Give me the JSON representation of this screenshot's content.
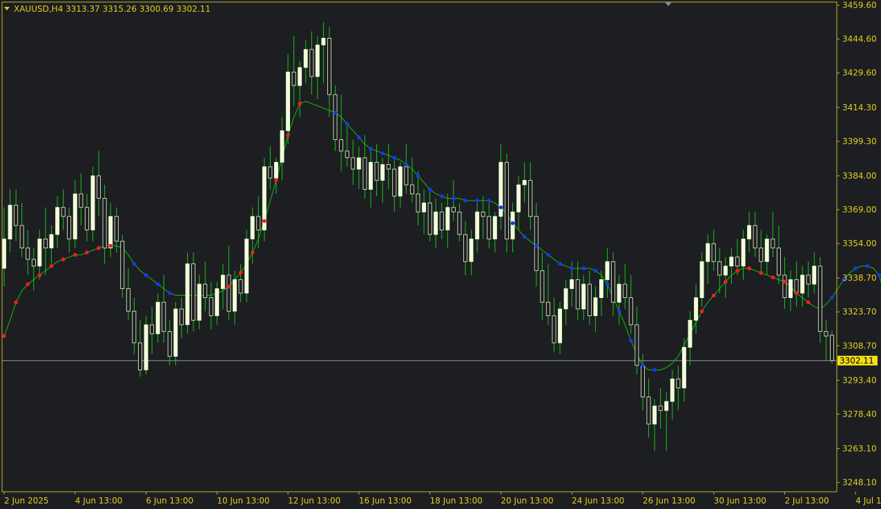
{
  "header": {
    "symbol_timeframe": "XAUUSD,H4",
    "ohlc": "3313.37 3315.26 3300.69 3302.11"
  },
  "colors": {
    "background": "#1d1e22",
    "frame": "#c9b82e",
    "axis_text": "#e2cf1e",
    "candle_bull_fill": "#f0ffd8",
    "candle_bear_fill": "#1d1e22",
    "candle_outline": "#f0ffd8",
    "wick": "#17c917",
    "ma_line": "#12a012",
    "dot_up": "#ff1a1a",
    "dot_down": "#1238ff",
    "last_price_bg": "#f5dd14",
    "last_price_line": "#9a9a9a"
  },
  "chart_data": {
    "type": "candlestick",
    "symbol": "XAUUSD",
    "timeframe": "H4",
    "y_ticks": [
      "3459.60",
      "3444.60",
      "3429.60",
      "3414.30",
      "3399.30",
      "3384.00",
      "3369.00",
      "3354.00",
      "3338.70",
      "3323.70",
      "3308.70",
      "3293.40",
      "3278.40",
      "3263.10",
      "3248.10"
    ],
    "ylim": [
      3244.0,
      3461.0
    ],
    "x_ticks": [
      {
        "i": 0,
        "label": "2 Jun 2025"
      },
      {
        "i": 12,
        "label": "4 Jun 13:00"
      },
      {
        "i": 24,
        "label": "6 Jun 13:00"
      },
      {
        "i": 36,
        "label": "10 Jun 13:00"
      },
      {
        "i": 48,
        "label": "12 Jun 13:00"
      },
      {
        "i": 60,
        "label": "16 Jun 13:00"
      },
      {
        "i": 72,
        "label": "18 Jun 13:00"
      },
      {
        "i": 84,
        "label": "20 Jun 13:00"
      },
      {
        "i": 96,
        "label": "24 Jun 13:00"
      },
      {
        "i": 108,
        "label": "26 Jun 13:00"
      },
      {
        "i": 120,
        "label": "30 Jun 13:00"
      },
      {
        "i": 132,
        "label": "2 Jul 13:00"
      },
      {
        "i": 144,
        "label": "4 Jul 13:00"
      }
    ],
    "last_price": "3302.11",
    "candles_ohlc": [
      [
        3343,
        3370,
        3335,
        3356
      ],
      [
        3356,
        3378,
        3350,
        3371
      ],
      [
        3371,
        3378,
        3355,
        3362
      ],
      [
        3362,
        3372,
        3348,
        3352
      ],
      [
        3352,
        3360,
        3340,
        3347
      ],
      [
        3347,
        3352,
        3333,
        3344
      ],
      [
        3344,
        3360,
        3338,
        3356
      ],
      [
        3356,
        3370,
        3340,
        3352
      ],
      [
        3352,
        3362,
        3345,
        3358
      ],
      [
        3358,
        3375,
        3352,
        3370
      ],
      [
        3370,
        3378,
        3360,
        3366
      ],
      [
        3366,
        3370,
        3350,
        3356
      ],
      [
        3356,
        3382,
        3352,
        3376
      ],
      [
        3376,
        3385,
        3362,
        3370
      ],
      [
        3370,
        3376,
        3355,
        3360
      ],
      [
        3360,
        3388,
        3355,
        3384
      ],
      [
        3384,
        3395,
        3366,
        3374
      ],
      [
        3374,
        3380,
        3345,
        3352
      ],
      [
        3352,
        3372,
        3348,
        3366
      ],
      [
        3366,
        3370,
        3350,
        3355
      ],
      [
        3355,
        3358,
        3330,
        3334
      ],
      [
        3334,
        3343,
        3320,
        3324
      ],
      [
        3324,
        3330,
        3305,
        3310
      ],
      [
        3310,
        3320,
        3295,
        3298
      ],
      [
        3298,
        3322,
        3296,
        3318
      ],
      [
        3318,
        3326,
        3305,
        3314
      ],
      [
        3314,
        3332,
        3310,
        3328
      ],
      [
        3328,
        3340,
        3310,
        3315
      ],
      [
        3315,
        3320,
        3300,
        3304
      ],
      [
        3304,
        3328,
        3300,
        3325
      ],
      [
        3325,
        3330,
        3312,
        3318
      ],
      [
        3318,
        3350,
        3314,
        3345
      ],
      [
        3345,
        3350,
        3315,
        3320
      ],
      [
        3320,
        3340,
        3316,
        3336
      ],
      [
        3336,
        3346,
        3324,
        3330
      ],
      [
        3330,
        3337,
        3316,
        3322
      ],
      [
        3322,
        3337,
        3318,
        3334
      ],
      [
        3334,
        3345,
        3325,
        3340
      ],
      [
        3340,
        3353,
        3320,
        3324
      ],
      [
        3324,
        3342,
        3318,
        3338
      ],
      [
        3338,
        3345,
        3328,
        3332
      ],
      [
        3332,
        3360,
        3328,
        3356
      ],
      [
        3356,
        3370,
        3345,
        3366
      ],
      [
        3366,
        3375,
        3352,
        3360
      ],
      [
        3360,
        3392,
        3355,
        3388
      ],
      [
        3388,
        3397,
        3378,
        3383
      ],
      [
        3383,
        3392,
        3376,
        3390
      ],
      [
        3390,
        3410,
        3382,
        3404
      ],
      [
        3404,
        3438,
        3398,
        3430
      ],
      [
        3430,
        3446,
        3415,
        3424
      ],
      [
        3424,
        3435,
        3410,
        3432
      ],
      [
        3432,
        3444,
        3425,
        3440
      ],
      [
        3440,
        3448,
        3420,
        3428
      ],
      [
        3428,
        3446,
        3418,
        3442
      ],
      [
        3442,
        3452,
        3425,
        3445
      ],
      [
        3445,
        3450,
        3410,
        3420
      ],
      [
        3420,
        3424,
        3395,
        3400
      ],
      [
        3400,
        3420,
        3386,
        3395
      ],
      [
        3395,
        3408,
        3388,
        3392
      ],
      [
        3392,
        3400,
        3380,
        3387
      ],
      [
        3387,
        3397,
        3378,
        3392
      ],
      [
        3392,
        3402,
        3374,
        3378
      ],
      [
        3378,
        3396,
        3370,
        3390
      ],
      [
        3390,
        3398,
        3375,
        3382
      ],
      [
        3382,
        3392,
        3372,
        3389
      ],
      [
        3389,
        3398,
        3378,
        3387
      ],
      [
        3387,
        3392,
        3368,
        3375
      ],
      [
        3375,
        3390,
        3370,
        3388
      ],
      [
        3388,
        3398,
        3376,
        3380
      ],
      [
        3380,
        3392,
        3372,
        3376
      ],
      [
        3376,
        3386,
        3362,
        3368
      ],
      [
        3368,
        3378,
        3358,
        3372
      ],
      [
        3372,
        3378,
        3355,
        3358
      ],
      [
        3358,
        3374,
        3352,
        3368
      ],
      [
        3368,
        3372,
        3356,
        3360
      ],
      [
        3360,
        3376,
        3352,
        3370
      ],
      [
        3370,
        3382,
        3364,
        3368
      ],
      [
        3368,
        3372,
        3355,
        3358
      ],
      [
        3358,
        3364,
        3340,
        3346
      ],
      [
        3346,
        3360,
        3340,
        3356
      ],
      [
        3356,
        3372,
        3350,
        3368
      ],
      [
        3368,
        3375,
        3356,
        3366
      ],
      [
        3366,
        3372,
        3352,
        3356
      ],
      [
        3356,
        3368,
        3350,
        3366
      ],
      [
        3366,
        3398,
        3360,
        3390
      ],
      [
        3390,
        3394,
        3350,
        3356
      ],
      [
        3356,
        3372,
        3350,
        3368
      ],
      [
        3368,
        3384,
        3360,
        3380
      ],
      [
        3380,
        3390,
        3372,
        3382
      ],
      [
        3382,
        3390,
        3360,
        3366
      ],
      [
        3366,
        3372,
        3335,
        3342
      ],
      [
        3342,
        3350,
        3320,
        3328
      ],
      [
        3328,
        3345,
        3318,
        3322
      ],
      [
        3322,
        3330,
        3306,
        3310
      ],
      [
        3310,
        3328,
        3305,
        3325
      ],
      [
        3325,
        3338,
        3318,
        3334
      ],
      [
        3334,
        3346,
        3326,
        3338
      ],
      [
        3338,
        3346,
        3320,
        3325
      ],
      [
        3325,
        3340,
        3320,
        3336
      ],
      [
        3336,
        3342,
        3318,
        3322
      ],
      [
        3322,
        3335,
        3315,
        3330
      ],
      [
        3330,
        3342,
        3322,
        3338
      ],
      [
        3338,
        3352,
        3330,
        3346
      ],
      [
        3346,
        3350,
        3322,
        3328
      ],
      [
        3328,
        3340,
        3318,
        3336
      ],
      [
        3336,
        3345,
        3325,
        3330
      ],
      [
        3330,
        3340,
        3314,
        3318
      ],
      [
        3318,
        3326,
        3296,
        3300
      ],
      [
        3300,
        3305,
        3280,
        3286
      ],
      [
        3286,
        3294,
        3268,
        3274
      ],
      [
        3274,
        3285,
        3262,
        3282
      ],
      [
        3282,
        3290,
        3272,
        3280
      ],
      [
        3280,
        3288,
        3262,
        3284
      ],
      [
        3284,
        3298,
        3276,
        3294
      ],
      [
        3294,
        3300,
        3280,
        3290
      ],
      [
        3290,
        3312,
        3284,
        3308
      ],
      [
        3308,
        3324,
        3300,
        3320
      ],
      [
        3320,
        3336,
        3314,
        3330
      ],
      [
        3330,
        3350,
        3326,
        3346
      ],
      [
        3346,
        3358,
        3336,
        3354
      ],
      [
        3354,
        3360,
        3342,
        3346
      ],
      [
        3346,
        3352,
        3332,
        3340
      ],
      [
        3340,
        3348,
        3330,
        3344
      ],
      [
        3344,
        3352,
        3336,
        3348
      ],
      [
        3348,
        3356,
        3340,
        3344
      ],
      [
        3344,
        3360,
        3338,
        3356
      ],
      [
        3356,
        3368,
        3350,
        3362
      ],
      [
        3362,
        3368,
        3348,
        3352
      ],
      [
        3352,
        3360,
        3340,
        3346
      ],
      [
        3346,
        3358,
        3340,
        3356
      ],
      [
        3356,
        3368,
        3348,
        3352
      ],
      [
        3352,
        3362,
        3336,
        3340
      ],
      [
        3340,
        3348,
        3325,
        3330
      ],
      [
        3330,
        3342,
        3324,
        3338
      ],
      [
        3338,
        3346,
        3326,
        3332
      ],
      [
        3332,
        3344,
        3326,
        3340
      ],
      [
        3340,
        3346,
        3330,
        3336
      ],
      [
        3336,
        3350,
        3332,
        3344
      ],
      [
        3344,
        3348,
        3310,
        3315
      ],
      [
        3315,
        3320,
        3302,
        3313
      ],
      [
        3313.37,
        3315.26,
        3300.69,
        3302.11
      ]
    ],
    "ma_values": [
      3313,
      3320,
      3328,
      3333,
      3336,
      3338,
      3340,
      3342,
      3344,
      3346,
      3347,
      3348,
      3349,
      3349,
      3350,
      3351,
      3352,
      3353,
      3353,
      3353,
      3352,
      3349,
      3345,
      3342,
      3340,
      3338,
      3336,
      3334,
      3332,
      3331,
      3331,
      3331,
      3331,
      3331,
      3331,
      3331,
      3332,
      3333,
      3335,
      3338,
      3341,
      3345,
      3350,
      3356,
      3364,
      3373,
      3382,
      3392,
      3402,
      3410,
      3416,
      3417,
      3416,
      3415,
      3414,
      3413,
      3412,
      3410,
      3407,
      3404,
      3401,
      3398,
      3396,
      3395,
      3394,
      3393,
      3392,
      3391,
      3389,
      3387,
      3384,
      3381,
      3378,
      3376,
      3375,
      3374,
      3374,
      3374,
      3373,
      3373,
      3373,
      3373,
      3373,
      3372,
      3370,
      3367,
      3363,
      3360,
      3357,
      3355,
      3353,
      3351,
      3349,
      3347,
      3345,
      3344,
      3343,
      3343,
      3343,
      3343,
      3342,
      3340,
      3336,
      3330,
      3324,
      3318,
      3311,
      3305,
      3300,
      3298,
      3298,
      3298,
      3299,
      3301,
      3304,
      3309,
      3314,
      3319,
      3324,
      3328,
      3331,
      3334,
      3337,
      3340,
      3342,
      3343,
      3343,
      3342,
      3341,
      3340,
      3339,
      3338,
      3337,
      3335,
      3332,
      3330,
      3328,
      3326,
      3325,
      3327,
      3330,
      3334,
      3338,
      3341,
      3343,
      3344,
      3344,
      3343,
      3340,
      3330
    ],
    "dots": [
      {
        "i": 0,
        "c": "red"
      },
      {
        "i": 2,
        "c": "red"
      },
      {
        "i": 4,
        "c": "red"
      },
      {
        "i": 6,
        "c": "red"
      },
      {
        "i": 8,
        "c": "red"
      },
      {
        "i": 10,
        "c": "red"
      },
      {
        "i": 12,
        "c": "red"
      },
      {
        "i": 14,
        "c": "red"
      },
      {
        "i": 16,
        "c": "red"
      },
      {
        "i": 18,
        "c": "red"
      },
      {
        "i": 22,
        "c": "blue"
      },
      {
        "i": 24,
        "c": "blue"
      },
      {
        "i": 26,
        "c": "blue"
      },
      {
        "i": 28,
        "c": "blue"
      },
      {
        "i": 38,
        "c": "red"
      },
      {
        "i": 40,
        "c": "red"
      },
      {
        "i": 42,
        "c": "red"
      },
      {
        "i": 44,
        "c": "red"
      },
      {
        "i": 46,
        "c": "red"
      },
      {
        "i": 48,
        "c": "red"
      },
      {
        "i": 50,
        "c": "red"
      },
      {
        "i": 56,
        "c": "blue"
      },
      {
        "i": 58,
        "c": "blue"
      },
      {
        "i": 60,
        "c": "blue"
      },
      {
        "i": 62,
        "c": "blue"
      },
      {
        "i": 64,
        "c": "blue"
      },
      {
        "i": 66,
        "c": "blue"
      },
      {
        "i": 68,
        "c": "blue"
      },
      {
        "i": 70,
        "c": "blue"
      },
      {
        "i": 72,
        "c": "blue"
      },
      {
        "i": 74,
        "c": "blue"
      },
      {
        "i": 76,
        "c": "blue"
      },
      {
        "i": 78,
        "c": "blue"
      },
      {
        "i": 80,
        "c": "blue"
      },
      {
        "i": 82,
        "c": "blue"
      },
      {
        "i": 84,
        "c": "blue"
      },
      {
        "i": 86,
        "c": "blue"
      },
      {
        "i": 88,
        "c": "blue"
      },
      {
        "i": 90,
        "c": "blue"
      },
      {
        "i": 92,
        "c": "blue"
      },
      {
        "i": 94,
        "c": "blue"
      },
      {
        "i": 96,
        "c": "blue"
      },
      {
        "i": 98,
        "c": "blue"
      },
      {
        "i": 100,
        "c": "blue"
      },
      {
        "i": 102,
        "c": "blue"
      },
      {
        "i": 104,
        "c": "blue"
      },
      {
        "i": 106,
        "c": "blue"
      },
      {
        "i": 108,
        "c": "blue"
      },
      {
        "i": 110,
        "c": "blue"
      },
      {
        "i": 118,
        "c": "red"
      },
      {
        "i": 120,
        "c": "red"
      },
      {
        "i": 122,
        "c": "red"
      },
      {
        "i": 124,
        "c": "red"
      },
      {
        "i": 126,
        "c": "red"
      },
      {
        "i": 128,
        "c": "red"
      },
      {
        "i": 130,
        "c": "red"
      },
      {
        "i": 132,
        "c": "red"
      },
      {
        "i": 134,
        "c": "red"
      },
      {
        "i": 136,
        "c": "red"
      },
      {
        "i": 140,
        "c": "blue"
      },
      {
        "i": 142,
        "c": "blue"
      },
      {
        "i": 144,
        "c": "blue"
      },
      {
        "i": 146,
        "c": "blue"
      },
      {
        "i": 148,
        "c": "blue"
      }
    ]
  }
}
